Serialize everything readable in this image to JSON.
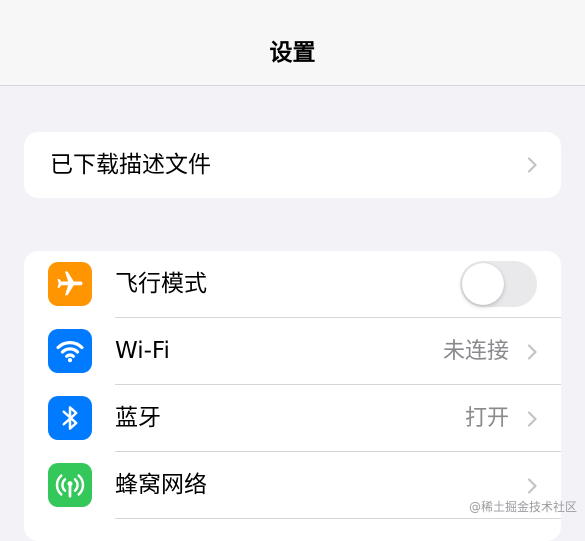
{
  "header": {
    "title": "设置"
  },
  "profile_card": {
    "label": "已下载描述文件"
  },
  "settings": {
    "airplane": {
      "label": "飞行模式",
      "toggle_on": false,
      "icon": "airplane-icon",
      "icon_color": "#FF9500"
    },
    "wifi": {
      "label": "Wi-Fi",
      "value": "未连接",
      "icon": "wifi-icon",
      "icon_color": "#007AFF"
    },
    "bluetooth": {
      "label": "蓝牙",
      "value": "打开",
      "icon": "bluetooth-icon",
      "icon_color": "#007AFF"
    },
    "cellular": {
      "label": "蜂窝网络",
      "icon": "antenna-icon",
      "icon_color": "#34C759"
    }
  },
  "watermark": "@稀土掘金技术社区"
}
